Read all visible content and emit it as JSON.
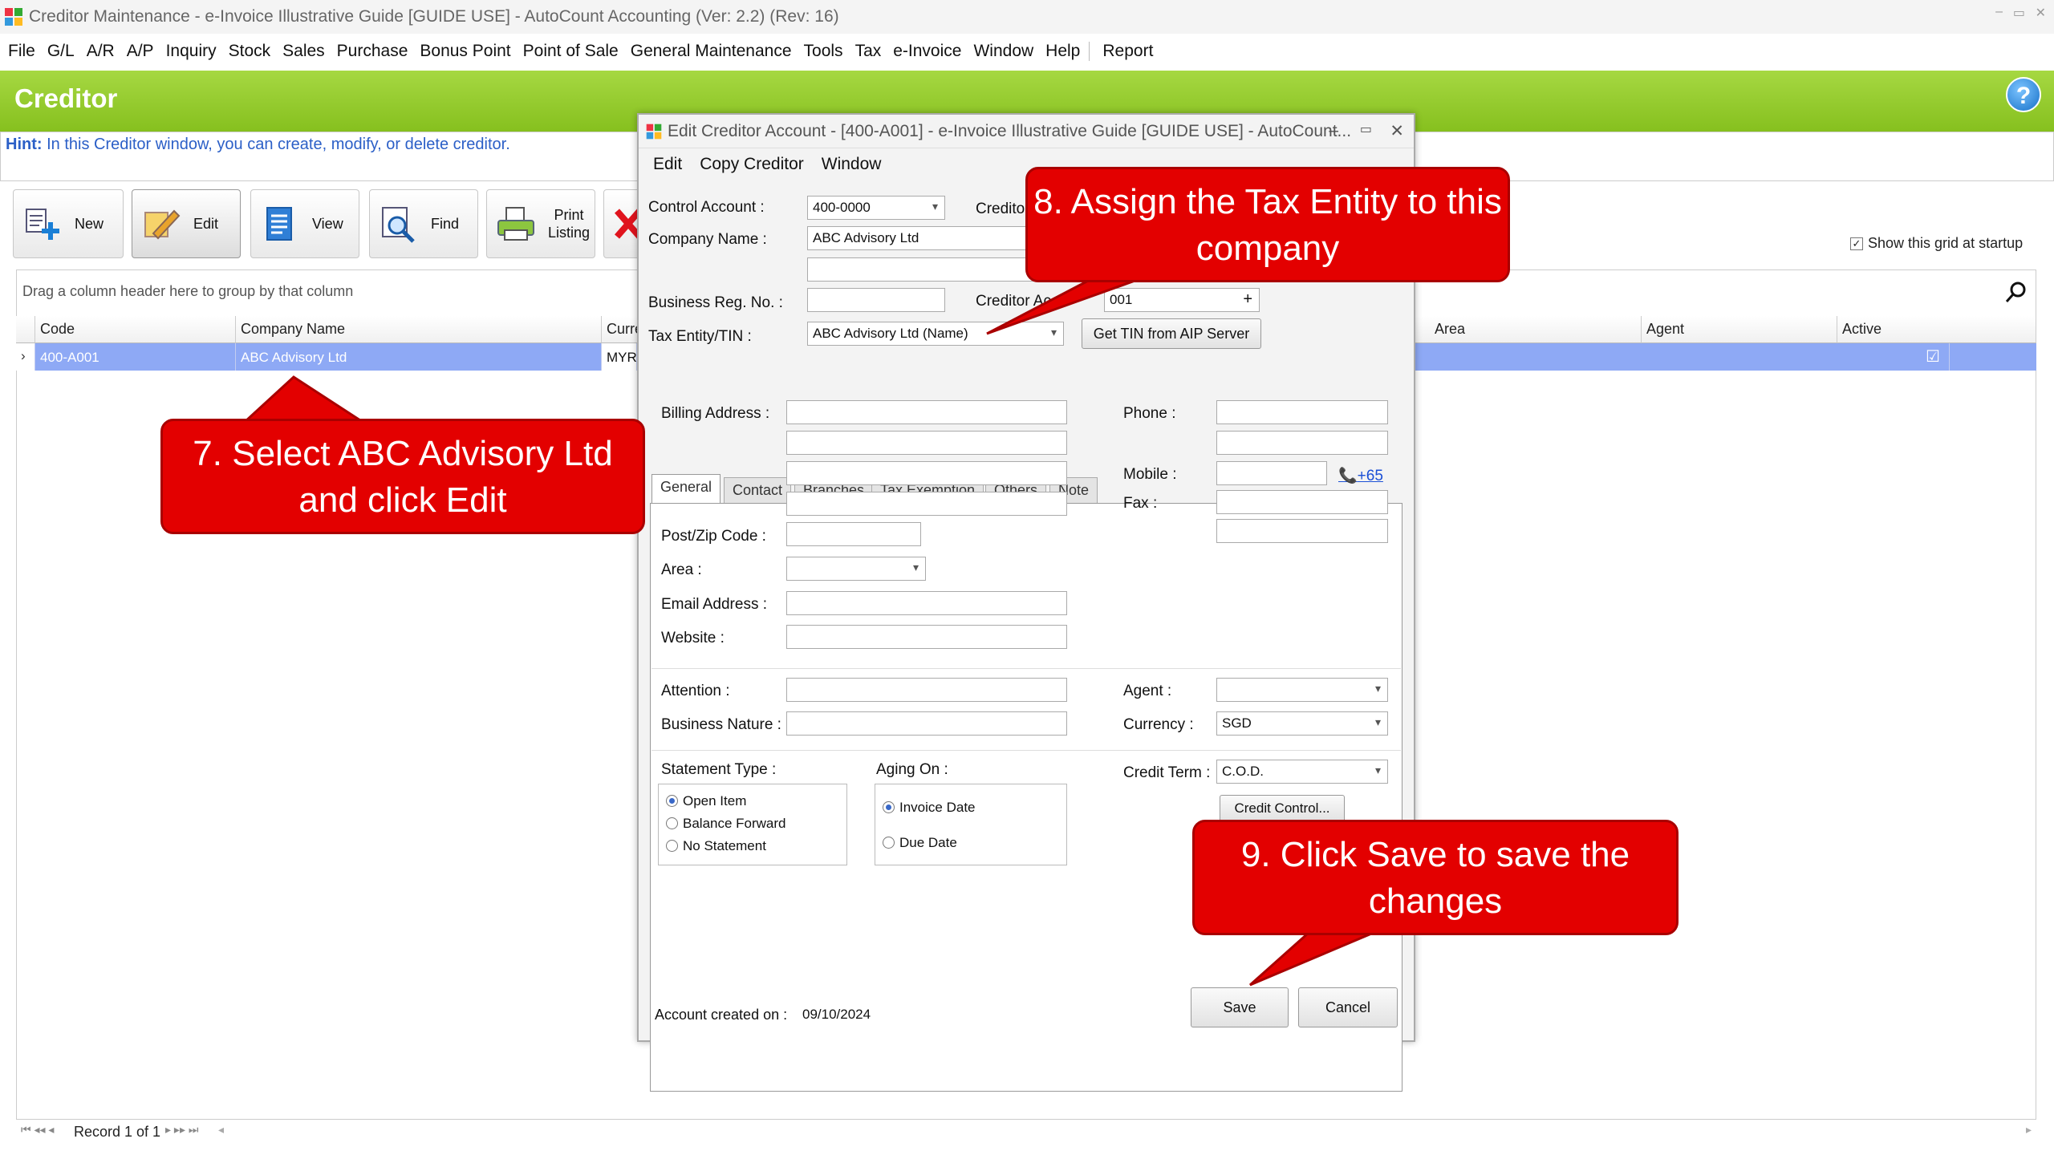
{
  "window": {
    "title": "Creditor Maintenance - e-Invoice Illustrative Guide [GUIDE USE] - AutoCount Accounting (Ver: 2.2) (Rev: 16)"
  },
  "menu": [
    "File",
    "G/L",
    "A/R",
    "A/P",
    "Inquiry",
    "Stock",
    "Sales",
    "Purchase",
    "Bonus Point",
    "Point of Sale",
    "General Maintenance",
    "Tools",
    "Tax",
    "e-Invoice",
    "Window",
    "Help",
    "Report"
  ],
  "header": {
    "title": "Creditor",
    "hint_label": "Hint:",
    "hint_text": " In this Creditor window, you can create, modify, or delete creditor."
  },
  "toolbar": {
    "new": "New",
    "edit": "Edit",
    "view": "View",
    "find": "Find",
    "print_line1": "Print",
    "print_line2": "Listing"
  },
  "grid": {
    "group_hint": "Drag a column header here to group by that column",
    "show_grid": "Show this grid at startup",
    "columns": {
      "code": "Code",
      "company": "Company Name",
      "currency": "Curre",
      "area": "Area",
      "agent": "Agent",
      "active": "Active"
    },
    "row": {
      "code": "400-A001",
      "company": "ABC Advisory Ltd",
      "currency": "MYR",
      "active": "☑"
    },
    "record": "Record 1 of 1"
  },
  "dialog": {
    "title": "Edit Creditor Account - [400-A001] - e-Invoice Illustrative Guide [GUIDE USE] - AutoCount...",
    "menu": [
      "Edit",
      "Copy Creditor",
      "Window"
    ],
    "control_account_label": "Control Account :",
    "control_account": "400-0000",
    "creditor_label": "Creditor",
    "company_name_label": "Company Name :",
    "company_name": "ABC Advisory Ltd",
    "business_reg_label": "Business Reg. No. :",
    "creditor_acc_label": "Creditor Acco",
    "creditor_acc_value": "001",
    "tax_entity_label": "Tax Entity/TIN  :",
    "tax_entity": "ABC Advisory Ltd (Name)",
    "get_tin_button": "Get TIN from AIP Server",
    "tabs": [
      "General",
      "Contact",
      "Branches",
      "Tax Exemption",
      "Others",
      "Note"
    ],
    "billing_address_label": "Billing Address :",
    "postcode_label": "Post/Zip Code :",
    "area_label": "Area :",
    "email_label": "Email  Address :",
    "website_label": "Website :",
    "phone_label": "Phone :",
    "mobile_label": "Mobile :",
    "mobile_prefix": "+65",
    "fax_label": "Fax :",
    "attention_label": "Attention :",
    "business_nature_label": "Business Nature :",
    "agent_label": "Agent :",
    "currency_label": "Currency :",
    "currency": "SGD",
    "statement_type_label": "Statement Type :",
    "statement_options": [
      "Open Item",
      "Balance Forward",
      "No Statement"
    ],
    "aging_label": "Aging On :",
    "aging_options": [
      "Invoice Date",
      "Due Date"
    ],
    "credit_term_label": "Credit Term :",
    "credit_term": "C.O.D.",
    "credit_control_button": "Credit Control...",
    "created_label": "Account created on :",
    "created_date": "09/10/2024",
    "save_button": "Save",
    "cancel_button": "Cancel"
  },
  "callouts": {
    "step7": "7. Select ABC Advisory Ltd and click Edit",
    "step8": "8. Assign the Tax Entity to this company",
    "step9": "9. Click Save to save the changes"
  },
  "colors": {
    "accent_green": "#8cc63f",
    "selection": "#8ea9f5",
    "callout_red": "#e30000",
    "hint_blue": "#2b5fc7"
  }
}
